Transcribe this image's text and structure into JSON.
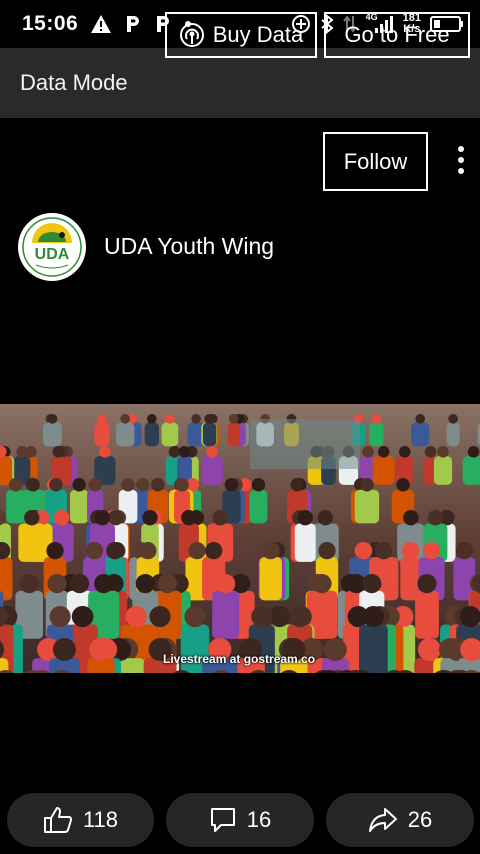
{
  "status_bar": {
    "time": "15:06",
    "network_type": "4G",
    "speed_value": "181",
    "speed_unit": "K/s",
    "icons": [
      "warning-icon",
      "p-notification-icon",
      "p-notification-icon",
      "dot-icon",
      "data-saver-icon",
      "bluetooth-icon",
      "data-arrows-icon",
      "signal-icon",
      "battery-icon"
    ]
  },
  "data_bar": {
    "mode_label": "Data Mode",
    "buy_label": "Buy Data",
    "free_label": "Go to Free"
  },
  "post": {
    "follow_label": "Follow",
    "channel_name": "UDA Youth Wing",
    "avatar_text": "UDA"
  },
  "video": {
    "watermark": "Livestream at gostream.co"
  },
  "actions": {
    "likes": "118",
    "comments": "16",
    "shares": "26"
  }
}
